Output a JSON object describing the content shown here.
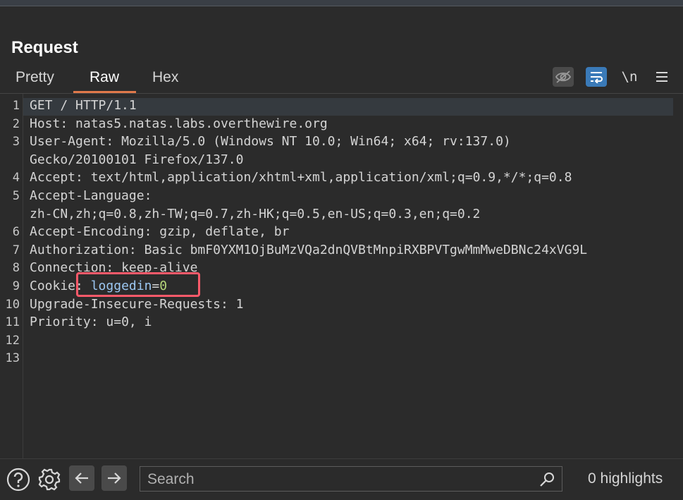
{
  "panel": {
    "title": "Request"
  },
  "tabs": [
    {
      "label": "Pretty"
    },
    {
      "label": "Raw"
    },
    {
      "label": "Hex"
    }
  ],
  "toolbar": {
    "newline_label": "\\n",
    "icons": [
      "eye-off-icon",
      "wrap-lines-icon",
      "newline-toggle",
      "menu-icon"
    ]
  },
  "editor": {
    "lines": [
      {
        "num": "1",
        "key": "GET / HTTP/1.1",
        "sep": "",
        "val": ""
      },
      {
        "num": "2",
        "key": "Host",
        "sep": ": ",
        "val": "natas5.natas.labs.overthewire.org"
      },
      {
        "num": "3",
        "key": "User-Agent",
        "sep": ": ",
        "val": "Mozilla/5.0 (Windows NT 10.0; Win64; x64; rv:137.0)"
      },
      {
        "num": "",
        "key": "",
        "sep": "",
        "val": "Gecko/20100101 Firefox/137.0"
      },
      {
        "num": "4",
        "key": "Accept",
        "sep": ": ",
        "val": "text/html,application/xhtml+xml,application/xml;q=0.9,*/*;q=0.8"
      },
      {
        "num": "5",
        "key": "Accept-Language",
        "sep": ":",
        "val": ""
      },
      {
        "num": "",
        "key": "",
        "sep": "",
        "val": "zh-CN,zh;q=0.8,zh-TW;q=0.7,zh-HK;q=0.5,en-US;q=0.3,en;q=0.2"
      },
      {
        "num": "6",
        "key": "Accept-Encoding",
        "sep": ": ",
        "val": "gzip, deflate, br"
      },
      {
        "num": "7",
        "key": "Authorization",
        "sep": ": ",
        "val": "Basic bmF0YXM1OjBuMzVQa2dnQVBtMnpiRXBPVTgwMmMweDBNc24xVG9L"
      },
      {
        "num": "8",
        "key": "Connection",
        "sep": ": ",
        "val": "keep-alive"
      },
      {
        "num": "9",
        "key": "Cookie",
        "sep": ": ",
        "cookie_name": "loggedin",
        "cookie_eq": "=",
        "cookie_val": "0"
      },
      {
        "num": "10",
        "key": "Upgrade-Insecure-Requests",
        "sep": ": ",
        "val": "1"
      },
      {
        "num": "11",
        "key": "Priority",
        "sep": ": ",
        "val": "u=0, i"
      },
      {
        "num": "12",
        "key": "",
        "sep": "",
        "val": ""
      },
      {
        "num": "13",
        "key": "",
        "sep": "",
        "val": ""
      }
    ]
  },
  "search": {
    "placeholder": "Search"
  },
  "status": {
    "highlights": "0 highlights"
  },
  "colors": {
    "accent": "#e0794a",
    "wrap_button": "#3a7ab8",
    "annotation_box": "#ff5a6a",
    "cookie_name": "#9cc7f2",
    "cookie_value": "#b6d67a"
  }
}
